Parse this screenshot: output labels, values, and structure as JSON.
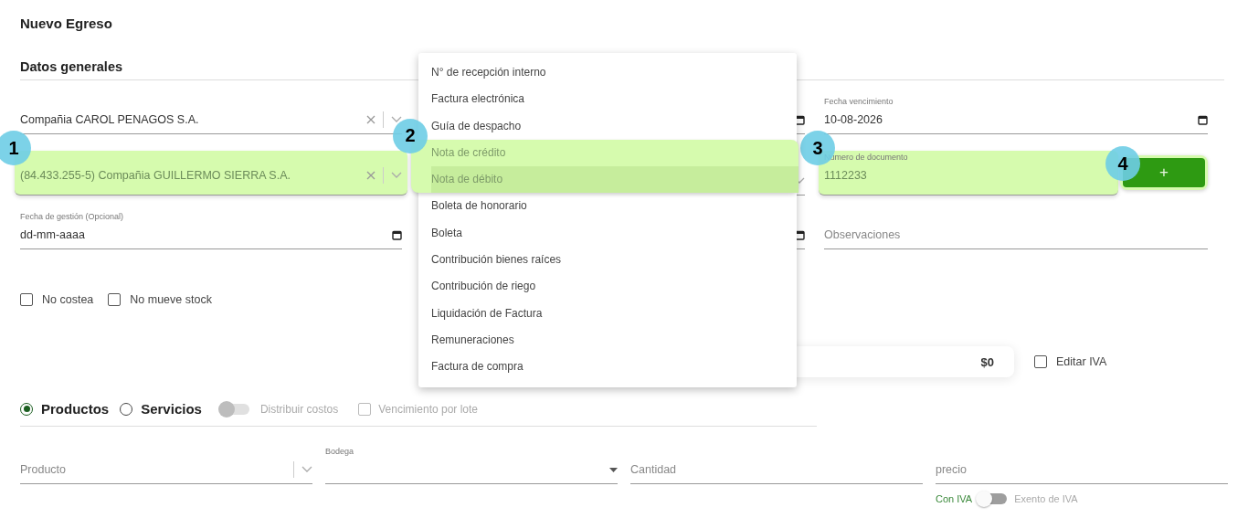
{
  "page_title": "Nuevo Egreso",
  "section_title": "Datos generales",
  "rows": [
    [
      {
        "kind": "select",
        "value": "Compañia CAROL PENAGOS S.A."
      },
      {
        "kind": "date"
      },
      {
        "kind": "date",
        "label": "Fecha vencimiento",
        "value": "10-08-2026"
      }
    ],
    [
      {
        "kind": "select",
        "value": "(84.433.255-5) Compañia GUILLERMO SIERRA S.A.",
        "annotation": "1"
      },
      {
        "kind": "select"
      },
      {
        "kind": "text",
        "label": "Numero de documento",
        "value": "1112233",
        "annotation": "3"
      }
    ],
    [
      {
        "kind": "date",
        "label": "Fecha de gestión (Opcional)",
        "value": "dd-mm-aaaa"
      },
      {
        "kind": "date"
      },
      {
        "kind": "text",
        "placeholder": "Observaciones"
      }
    ]
  ],
  "add_button": {
    "label": "+",
    "annotation": "4"
  },
  "checkboxes": [
    {
      "label": "No costea",
      "checked": false
    },
    {
      "label": "No mueve stock",
      "checked": false
    }
  ],
  "total": {
    "value": "$0"
  },
  "edit_iva": {
    "label": "Editar IVA",
    "checked": false
  },
  "item_types": [
    {
      "label": "Productos",
      "selected": true
    },
    {
      "label": "Servicios",
      "selected": false
    }
  ],
  "distribute": {
    "label": "Distribuir costos",
    "on": false
  },
  "lot_expiry": {
    "label": "Vencimiento por lote",
    "checked": false
  },
  "line_fields": [
    {
      "kind": "select",
      "placeholder": "Producto"
    },
    {
      "kind": "dropdown",
      "label": "Bodega"
    },
    {
      "kind": "text",
      "placeholder": "Cantidad"
    },
    {
      "kind": "text",
      "placeholder": "precio"
    }
  ],
  "iva_toggle": {
    "left": "Con IVA",
    "right": "Exento de IVA",
    "on": false
  },
  "menu": {
    "annotation": "2",
    "items": [
      {
        "label": "N° de recepción interno",
        "selected": false,
        "highlighted": false
      },
      {
        "label": "Factura electrónica",
        "selected": false,
        "highlighted": false
      },
      {
        "label": "Guía de despacho",
        "selected": false,
        "highlighted": false
      },
      {
        "label": "Nota de crédito",
        "selected": false,
        "highlighted": true
      },
      {
        "label": "Nota de débito",
        "selected": true,
        "highlighted": true
      },
      {
        "label": "Boleta de honorario",
        "selected": false,
        "highlighted": false
      },
      {
        "label": "Boleta",
        "selected": false,
        "highlighted": false
      },
      {
        "label": "Contribución bienes raíces",
        "selected": false,
        "highlighted": false
      },
      {
        "label": "Contribución de riego",
        "selected": false,
        "highlighted": false
      },
      {
        "label": "Liquidación de Factura",
        "selected": false,
        "highlighted": false
      },
      {
        "label": "Remuneraciones",
        "selected": false,
        "highlighted": false
      },
      {
        "label": "Factura de compra",
        "selected": false,
        "highlighted": false
      }
    ]
  }
}
